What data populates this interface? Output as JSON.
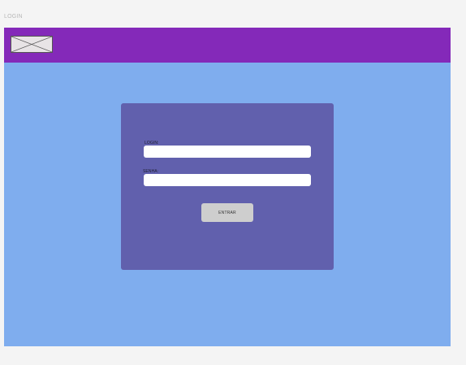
{
  "frame": {
    "label": "LOGIN"
  },
  "header": {
    "logo_icon": "image-placeholder-icon"
  },
  "form": {
    "login_label": "LOGIN:",
    "login_value": "",
    "senha_label": "SENHA:",
    "senha_value": "",
    "submit_label": "ENTRAR"
  },
  "colors": {
    "page_background": "#f4f4f4",
    "frame_background": "#7fadee",
    "header_background": "#8429b9",
    "card_background": "#6160ad",
    "input_background": "#ffffff",
    "button_background": "#cecece"
  }
}
